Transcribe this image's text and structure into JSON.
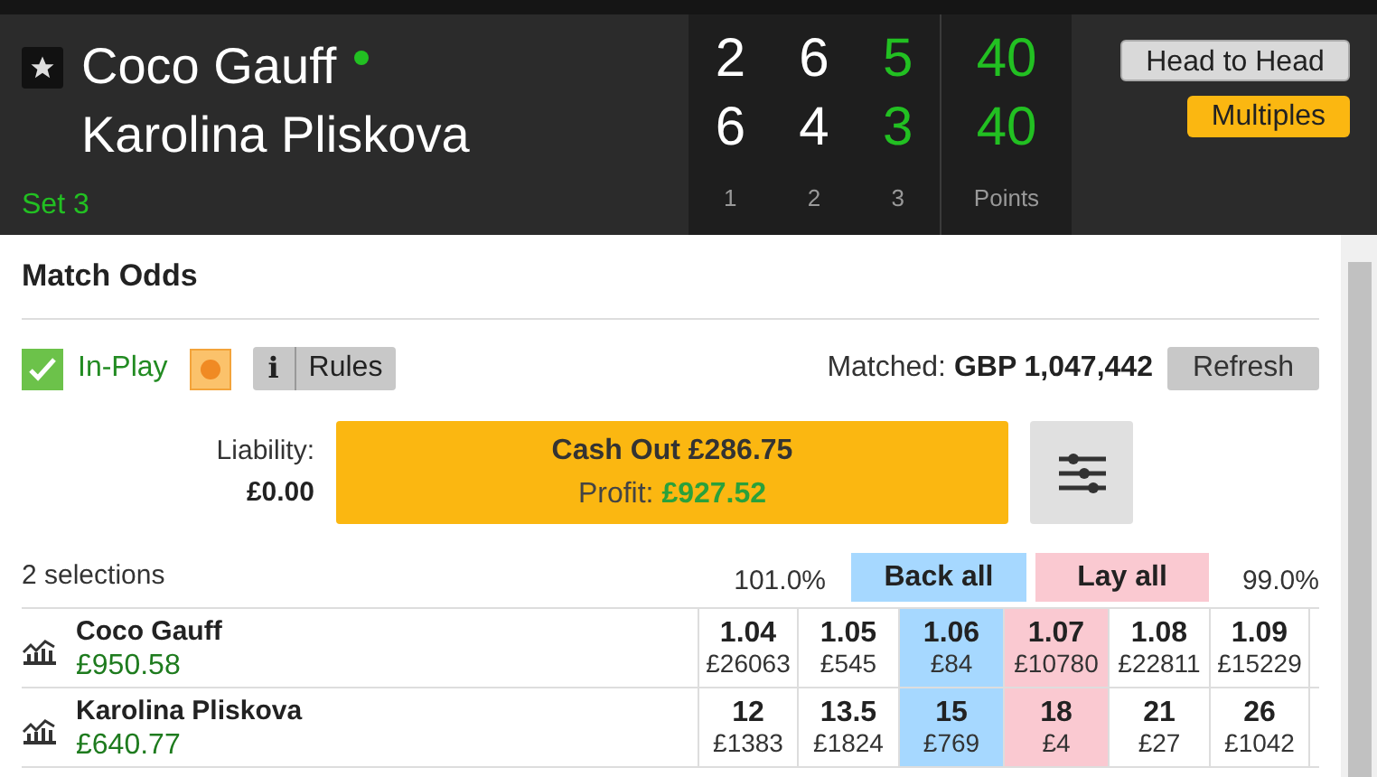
{
  "header": {
    "players": [
      {
        "name": "Coco Gauff",
        "serving": true,
        "sets": [
          "2",
          "6",
          "5"
        ],
        "points": "40"
      },
      {
        "name": "Karolina Pliskova",
        "serving": false,
        "sets": [
          "6",
          "4",
          "3"
        ],
        "points": "40"
      }
    ],
    "set_label": "Set 3",
    "set_columns": [
      {
        "label": "1",
        "current": false
      },
      {
        "label": "2",
        "current": false
      },
      {
        "label": "3",
        "current": true
      }
    ],
    "points_label": "Points",
    "buttons": [
      {
        "label": "Head to Head",
        "kind": "plain"
      },
      {
        "label": "Multiples",
        "kind": "accent"
      }
    ]
  },
  "market": {
    "title": "Match Odds",
    "in_play": {
      "label": "In-Play",
      "checked": true
    },
    "info_label": "i",
    "rules_label": "Rules",
    "matched_label": "Matched:",
    "matched_value": "GBP 1,047,442",
    "refresh_label": "Refresh",
    "cash_out": {
      "liability_label": "Liability:",
      "liability_value": "£0.00",
      "title": "Cash Out £286.75",
      "profit_label": "Profit:",
      "profit_value": "£927.52"
    },
    "selections_label": "2 selections",
    "back_overround": "101.0%",
    "back_all_label": "Back all",
    "lay_all_label": "Lay all",
    "lay_overround": "99.0%",
    "runners": [
      {
        "name": "Coco Gauff",
        "pnl": "£950.58",
        "prices": [
          {
            "odds": "1.04",
            "size": "£26063",
            "kind": "back",
            "best": false
          },
          {
            "odds": "1.05",
            "size": "£545",
            "kind": "back",
            "best": false
          },
          {
            "odds": "1.06",
            "size": "£84",
            "kind": "back",
            "best": true
          },
          {
            "odds": "1.07",
            "size": "£10780",
            "kind": "lay",
            "best": true
          },
          {
            "odds": "1.08",
            "size": "£22811",
            "kind": "lay",
            "best": false
          },
          {
            "odds": "1.09",
            "size": "£15229",
            "kind": "lay",
            "best": false
          }
        ]
      },
      {
        "name": "Karolina Pliskova",
        "pnl": "£640.77",
        "prices": [
          {
            "odds": "12",
            "size": "£1383",
            "kind": "back",
            "best": false
          },
          {
            "odds": "13.5",
            "size": "£1824",
            "kind": "back",
            "best": false
          },
          {
            "odds": "15",
            "size": "£769",
            "kind": "back",
            "best": true
          },
          {
            "odds": "18",
            "size": "£4",
            "kind": "lay",
            "best": true
          },
          {
            "odds": "21",
            "size": "£27",
            "kind": "lay",
            "best": false
          },
          {
            "odds": "26",
            "size": "£1042",
            "kind": "lay",
            "best": false
          }
        ]
      }
    ]
  }
}
